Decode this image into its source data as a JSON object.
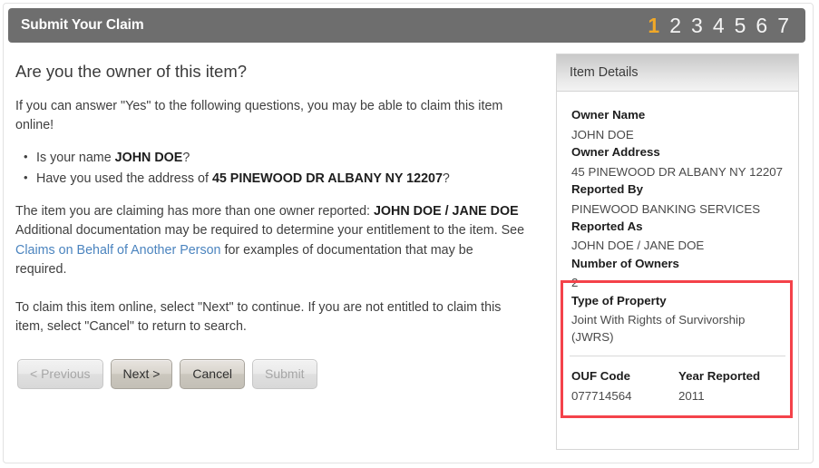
{
  "header": {
    "title": "Submit Your Claim",
    "steps": [
      "1",
      "2",
      "3",
      "4",
      "5",
      "6",
      "7"
    ],
    "active_step": "1",
    "active_color": "#f0a828",
    "bar_color": "#6e6e6e"
  },
  "main": {
    "heading": "Are you the owner of this item?",
    "intro": "If you can answer \"Yes\" to the following questions, you may be able to claim this item online!",
    "questions": [
      {
        "prefix": "Is your name ",
        "bold": "JOHN DOE",
        "suffix": "?"
      },
      {
        "prefix": "Have you used the address of ",
        "bold": "45 PINEWOOD DR ALBANY NY 12207",
        "suffix": "?"
      }
    ],
    "multi_owner": {
      "lead": "The item you are claiming has more than one owner reported: ",
      "owners": "JOHN DOE / JANE DOE",
      "doc_text": "Additional documentation may be required to determine your entitlement to the item. See ",
      "link_text": "Claims on Behalf of Another Person",
      "link_color": "#4b84bf",
      "tail_text": " for examples of documentation that may be required."
    },
    "instructions": "To claim this item online, select \"Next\" to continue. If you are not entitled to claim this item, select \"Cancel\" to return to search.",
    "buttons": [
      {
        "label": "< Previous",
        "state": "disabled"
      },
      {
        "label": "Next >",
        "state": "enabled"
      },
      {
        "label": "Cancel",
        "state": "enabled"
      },
      {
        "label": "Submit",
        "state": "disabled"
      }
    ]
  },
  "sidebar": {
    "title": "Item Details",
    "details": [
      {
        "label": "Owner Name",
        "value": "JOHN DOE"
      },
      {
        "label": "Owner Address",
        "value": "45 PINEWOOD DR ALBANY NY 12207"
      },
      {
        "label": "Reported By",
        "value": "PINEWOOD BANKING SERVICES"
      },
      {
        "label": "Reported As",
        "value": "JOHN DOE / JANE DOE"
      },
      {
        "label": "Number of Owners",
        "value": "2"
      },
      {
        "label": "Type of Property",
        "value": "Joint With Rights of Survivorship (JWRS)"
      }
    ],
    "highlight_color": "#f4424a",
    "footer": {
      "ouf_label": "OUF Code",
      "ouf_value": "077714564",
      "year_label": "Year Reported",
      "year_value": "2011"
    }
  }
}
